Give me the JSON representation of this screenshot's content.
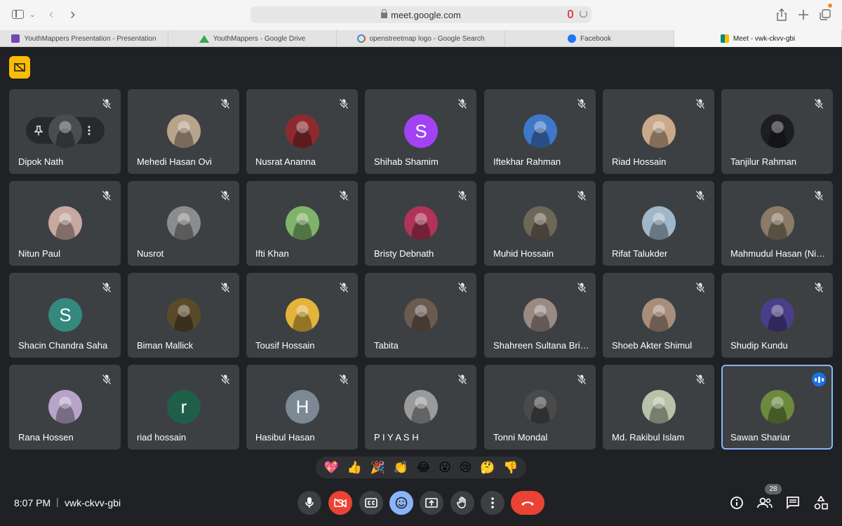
{
  "browser": {
    "url": "meet.google.com",
    "tabs": [
      {
        "label": "YouthMappers Presentation - Presentation",
        "icon": "slides-icon",
        "color": "#7248b9"
      },
      {
        "label": "YouthMappers - Google Drive",
        "icon": "drive-icon",
        "color": "#34a853"
      },
      {
        "label": "openstreetmap logo - Google Search",
        "icon": "google-icon",
        "color": "#4285f4"
      },
      {
        "label": "Facebook",
        "icon": "facebook-icon",
        "color": "#1877f2"
      },
      {
        "label": "Meet - vwk-ckvv-gbi",
        "icon": "meet-icon",
        "color": "#00897b",
        "active": true
      }
    ]
  },
  "meet": {
    "time": "8:07 PM",
    "separator": "|",
    "meeting_code": "vwk-ckvv-gbi",
    "participant_count": "28",
    "reactions": [
      "💖",
      "👍",
      "🎉",
      "👏",
      "😂",
      "😮",
      "😢",
      "🤔",
      "👎"
    ],
    "participants": [
      {
        "name": "Dipok Nath",
        "avatar": "photo",
        "color": "#4a4c50",
        "pinned_controls": true
      },
      {
        "name": "Mehedi Hasan Ovi",
        "avatar": "photo",
        "color": "#b8a48a"
      },
      {
        "name": "Nusrat Ananna",
        "avatar": "photo",
        "color": "#8e2a2f"
      },
      {
        "name": "Shihab Shamim",
        "avatar": "letter",
        "letter": "S",
        "color": "#a142f4"
      },
      {
        "name": "Iftekhar Rahman",
        "avatar": "photo",
        "color": "#3f78c9"
      },
      {
        "name": "Riad Hossain",
        "avatar": "photo",
        "color": "#c9a98a"
      },
      {
        "name": "Tanjilur Rahman",
        "avatar": "photo",
        "color": "#1e1e22"
      },
      {
        "name": "Nitun Paul",
        "avatar": "photo",
        "color": "#c8a9a0"
      },
      {
        "name": "Nusrot",
        "avatar": "photo",
        "color": "#8c8c8c"
      },
      {
        "name": "Ifti Khan",
        "avatar": "photo",
        "color": "#7fb36b"
      },
      {
        "name": "Bristy Debnath",
        "avatar": "photo",
        "color": "#b03358"
      },
      {
        "name": "Muhid Hossain",
        "avatar": "photo",
        "color": "#6e6658"
      },
      {
        "name": "Rifat Talukder",
        "avatar": "photo",
        "color": "#9fb7c9"
      },
      {
        "name": "Mahmudul Hasan (Nipun)",
        "avatar": "photo",
        "color": "#8a7a66"
      },
      {
        "name": "Shacin Chandra Saha",
        "avatar": "letter",
        "letter": "S",
        "color": "#34887e"
      },
      {
        "name": "Biman Mallick",
        "avatar": "photo",
        "color": "#5a4a2a"
      },
      {
        "name": "Tousif Hossain",
        "avatar": "photo",
        "color": "#e3b33a"
      },
      {
        "name": "Tabita",
        "avatar": "photo",
        "color": "#6a5a50"
      },
      {
        "name": "Shahreen Sultana Bristy",
        "avatar": "photo",
        "color": "#9a8a84"
      },
      {
        "name": "Shoeb Akter Shimul",
        "avatar": "photo",
        "color": "#a88e7a"
      },
      {
        "name": "Shudip Kundu",
        "avatar": "photo",
        "color": "#4a3e8a"
      },
      {
        "name": "Rana Hossen",
        "avatar": "photo",
        "color": "#b9a4c9"
      },
      {
        "name": "riad hossain",
        "avatar": "letter",
        "letter": "r",
        "color": "#1f5f4a"
      },
      {
        "name": "Hasibul Hasan",
        "avatar": "letter",
        "letter": "H",
        "color": "#7c8893"
      },
      {
        "name": "P I Y A S H",
        "avatar": "photo",
        "color": "#9a9a9a"
      },
      {
        "name": "Tonni Mondal",
        "avatar": "photo",
        "color": "#4a4a4a"
      },
      {
        "name": "Md. Rakibul Islam",
        "avatar": "photo",
        "color": "#b7c2a8"
      },
      {
        "name": "Sawan Shariar",
        "avatar": "photo",
        "color": "#6c8a3e",
        "speaking": true
      }
    ]
  }
}
